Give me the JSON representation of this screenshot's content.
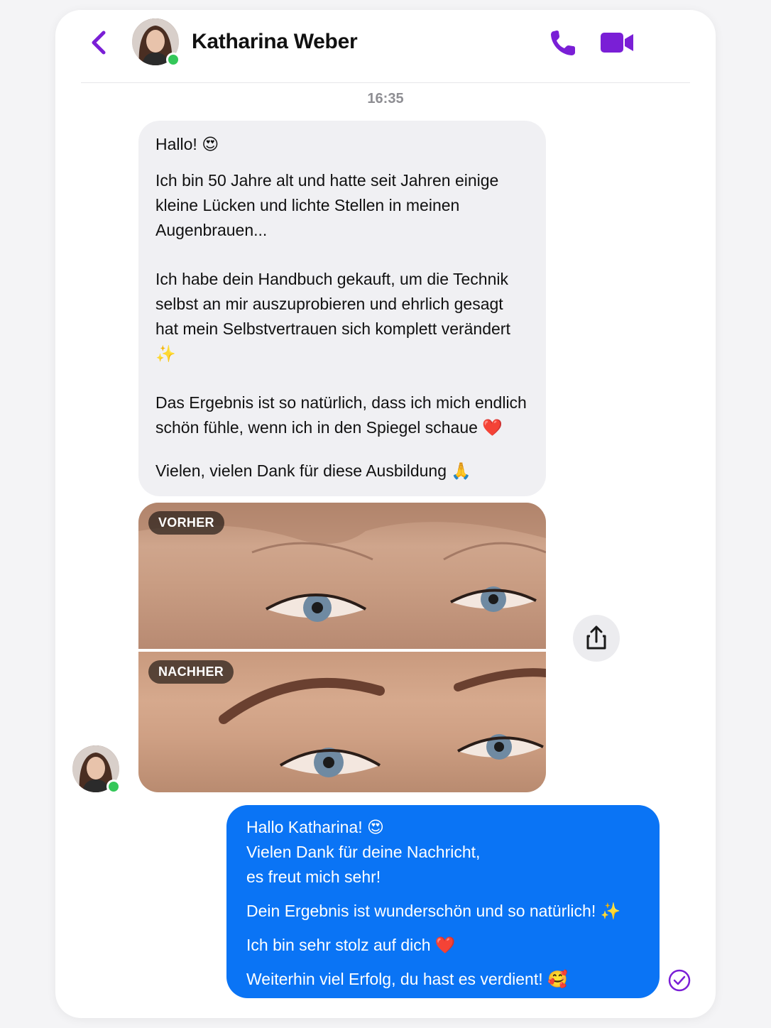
{
  "header": {
    "contact_name": "Katharina Weber",
    "status": "online"
  },
  "thread": {
    "timestamp": "16:35",
    "incoming": {
      "greeting": "Hallo! 😍",
      "paragraph_1": "Ich bin 50 Jahre alt und hatte seit Jahren einige kleine Lücken und lichte Stellen in meinen Augenbrauen...",
      "paragraph_2": "Ich habe dein Handbuch gekauft, um die Technik selbst an mir auszuprobieren und ehrlich gesagt hat mein Selbstvertrauen sich komplett verändert ✨",
      "paragraph_3": "Das Ergebnis ist so natürlich, dass ich mich endlich schön fühle, wenn ich in den Spiegel schaue ❤️",
      "paragraph_4": "Vielen, vielen Dank für diese Ausbildung 🙏"
    },
    "photos": {
      "before_label": "VORHER",
      "after_label": "NACHHER"
    },
    "outgoing": {
      "line_1": "Hallo Katharina! 😍",
      "line_2": "Vielen Dank für deine Nachricht,",
      "line_3": "es freut mich sehr!",
      "line_4": "Dein Ergebnis ist wunderschön und so natürlich! ✨",
      "line_5": "Ich bin sehr stolz auf dich ❤️",
      "line_6": "Weiterhin viel Erfolg, du hast es verdient! 🥰"
    }
  },
  "colors": {
    "accent": "#7a1fd6",
    "outgoing_bubble": "#0a74f5",
    "incoming_bubble": "#f0f0f3",
    "online": "#34c759"
  },
  "icons": [
    "chevron-left-icon",
    "phone-icon",
    "video-camera-icon",
    "share-icon",
    "read-check-icon"
  ]
}
